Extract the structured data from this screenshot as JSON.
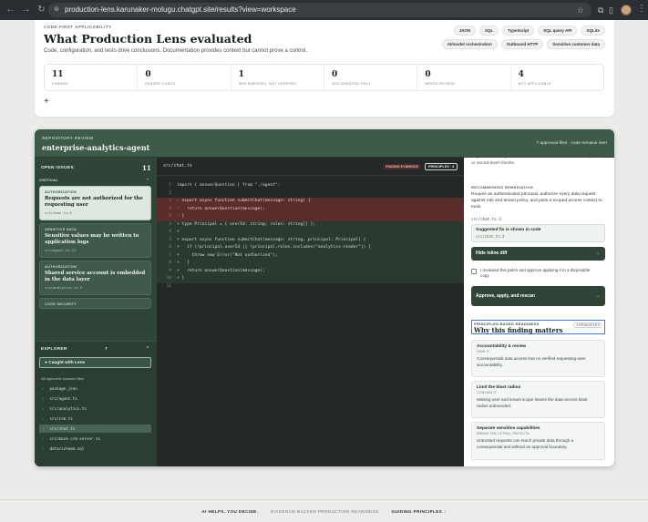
{
  "browser": {
    "url": "production-lens.karunaker-molugu.chatgpt.site/results?view=workspace",
    "back_icon": "arrow-left-icon",
    "forward_icon": "arrow-right-icon",
    "reload_icon": "reload-icon"
  },
  "evaluation": {
    "eyebrow": "CODE-FIRST APPLICABILITY",
    "title": "What Production Lens evaluated",
    "subtitle": "Code, configuration, and tests drive conclusions. Documentation provides context but cannot prove a control.",
    "chips": [
      "JSON",
      "SQL",
      "TypeScript",
      "SQL query API",
      "SQLite",
      "AI/model orchestration",
      "Outbound HTTP",
      "Sensitive customer data"
    ],
    "stats": [
      {
        "num": "11",
        "label": "FINDING"
      },
      {
        "num": "0",
        "label": "PASSED CHECK"
      },
      {
        "num": "1",
        "label": "IMPLEMENTED, NOT VERIFIED"
      },
      {
        "num": "0",
        "label": "DOCUMENTED ONLY"
      },
      {
        "num": "0",
        "label": "NEEDS REVIEW"
      },
      {
        "num": "4",
        "label": "NOT APPLICABLE"
      }
    ],
    "add_label": "+"
  },
  "repo": {
    "eyebrow": "REPOSITORY REVIEW",
    "title": "enterprise-analytics-agent",
    "meta": "7 approved files · code remains inert"
  },
  "issues": {
    "heading": "OPEN ISSUES",
    "count": "11",
    "severity": "CRITICAL",
    "severity_caret": "⌃",
    "items": [
      {
        "cat": "AUTHORIZATION",
        "title": "Requests are not authorized for the requesting user",
        "file": "src/chat.ts:3"
      },
      {
        "cat": "SENSITIVE DATA",
        "title": "Sensitive values may be written to application logs",
        "file": "src/agent.ts:11"
      },
      {
        "cat": "AUTHORIZATION",
        "title": "Shared service account is embedded in the data layer",
        "file": "src/analytics.ts:5"
      },
      {
        "cat": "CODE SECURITY",
        "title": "",
        "file": ""
      }
    ]
  },
  "explorer": {
    "heading": "EXPLORER",
    "count": "7",
    "caret": "⌃",
    "caught_label": "● Caught with Lens",
    "approved_label": "All approved scanned files",
    "files": [
      {
        "name": "package.json",
        "caret": "›"
      },
      {
        "name": "src/agent.ts",
        "caret": "›"
      },
      {
        "name": "src/analytics.ts",
        "caret": "›"
      },
      {
        "name": "src/crm.ts",
        "caret": "›"
      },
      {
        "name": "src/chat.ts",
        "caret": "›"
      },
      {
        "name": "src/mock-crm-server.ts",
        "caret": "›"
      },
      {
        "name": "data/schema.sql",
        "caret": "–"
      }
    ]
  },
  "code": {
    "file": "src/chat.ts",
    "tag_finding": "FINDING EVIDENCE",
    "tag_principles": "PRINCIPLES · 3",
    "lines": [
      {
        "n": "1",
        "text": "import { answerQuestion } from \"./agent\";"
      },
      {
        "n": "2",
        "text": ""
      },
      {
        "n": "3",
        "text": "- export async function submitChat(message: string) {"
      },
      {
        "n": "4",
        "text": "-   return answerQuestion(message);"
      },
      {
        "n": "5",
        "text": "- }"
      },
      {
        "n": "3",
        "text": "+ type Principal = { userId: string; roles: string[] };"
      },
      {
        "n": "4",
        "text": "+"
      },
      {
        "n": "5",
        "text": "+ export async function submitChat(message: string, principal: Principal) {"
      },
      {
        "n": "6",
        "text": "+   if (!principal.userId || !principal.roles.includes(\"analytics-reader\")) {"
      },
      {
        "n": "7",
        "text": "+     throw new Error(\"Not authorized\");"
      },
      {
        "n": "8",
        "text": "+   }"
      },
      {
        "n": "9",
        "text": "+   return answerQuestion(message);"
      },
      {
        "n": "10",
        "text": "+ }"
      },
      {
        "n": "11",
        "text": ""
      }
    ]
  },
  "remediation": {
    "top_text": "Any caller can request customer or revenue data without role, tenant, or record-level checks.",
    "eyebrow": "RECOMMENDED REMEDIATION",
    "text": "Require an authenticated principal, authorize every data request against role and tenant policy, and pass a scoped access context to tools.",
    "file_ref": "src/chat.ts:3",
    "suggested_title": "Suggested fix is shown in code",
    "suggested_file": "src/chat.ts:3",
    "hide_diff_label": "Hide inline diff",
    "arrow": "→",
    "checkbox_label": "I reviewed this patch and approve applying it to a disposable copy.",
    "apply_label": "Approve, apply, and rescan"
  },
  "principles": {
    "eyebrow": "PRINCIPLES-BASED READINESS",
    "title": "Why this finding matters",
    "badge": "3 PRINCIPLES",
    "items": [
      {
        "title": "Accountability & review",
        "sub": "OWN IT",
        "desc": "Consequential data access has no verified requesting-user accountability."
      },
      {
        "title": "Limit the blast radius",
        "sub": "CONTAIN IT",
        "desc": "Missing user and tenant scope leaves the data-access blast radius unbounded."
      },
      {
        "title": "Separate sensitive capabilities",
        "sub": "BREAK THE LETHAL TRIFECTA",
        "desc": "Untrusted requests can reach private data through a consequential tool without an approval boundary."
      }
    ]
  },
  "footer": {
    "a": "AI HELPS. YOU DECIDE.",
    "sep": "·",
    "b": "EVIDENCE-BACKED PRODUCTION READINESS",
    "c": "GUIDING PRINCIPLES ↓"
  },
  "colors": {
    "brand": "#2f4538",
    "diff_removed": "#5a2d2d",
    "diff_added": "#2b3a31"
  }
}
